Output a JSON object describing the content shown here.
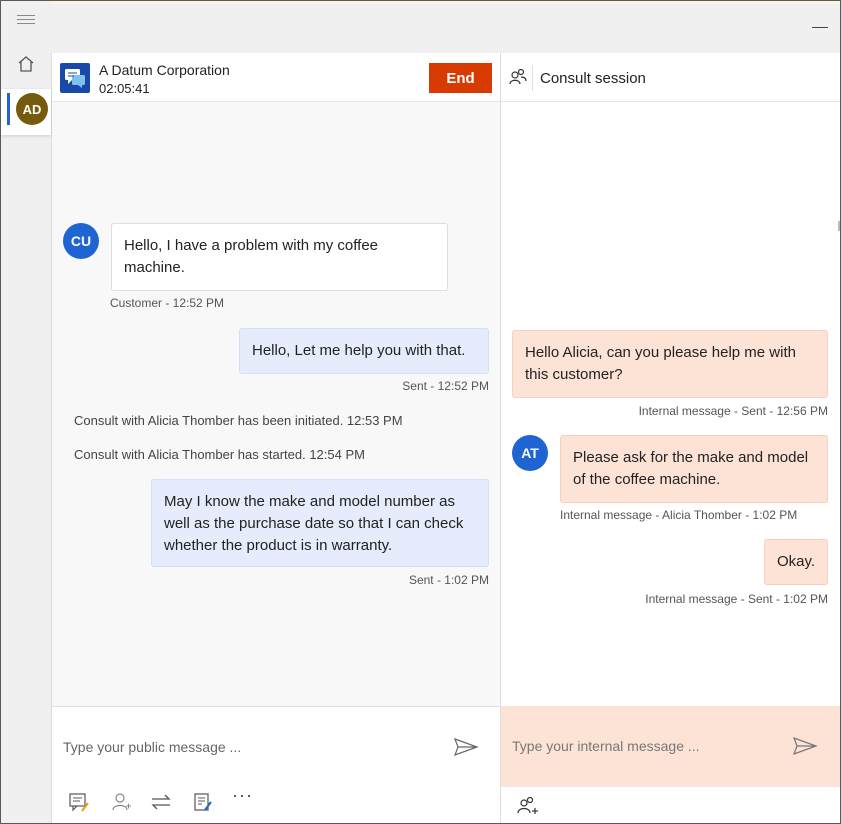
{
  "rail": {
    "avatar_initials": "AD"
  },
  "session": {
    "title": "A Datum Corporation",
    "timer": "02:05:41",
    "end_label": "End"
  },
  "conversation": {
    "customer_avatar": "CU",
    "messages": [
      {
        "kind": "customer",
        "text": "Hello, I have a problem with my coffee machine.",
        "meta": "Customer - 12:52 PM"
      },
      {
        "kind": "agent",
        "text": "Hello, Let me help you with that.",
        "meta": "Sent - 12:52 PM"
      },
      {
        "kind": "system",
        "text": "Consult with Alicia Thomber has been initiated. 12:53 PM"
      },
      {
        "kind": "system",
        "text": "Consult with Alicia Thomber has started. 12:54 PM"
      },
      {
        "kind": "agent",
        "text": "May I know the make and model number as well as the purchase date so that I can check whether the product is in warranty.",
        "meta": "Sent - 1:02 PM"
      }
    ],
    "input_placeholder": "Type your public message ..."
  },
  "consult": {
    "title": "Consult session",
    "consultant_avatar": "AT",
    "messages": [
      {
        "kind": "self",
        "text": "Hello Alicia, can you please help me with this customer?",
        "meta": "Internal message - Sent - 12:56 PM"
      },
      {
        "kind": "consultant",
        "text": "Please ask for the make and model of the coffee machine.",
        "meta": "Internal message - Alicia Thomber - 1:02 PM"
      },
      {
        "kind": "self",
        "text": "Okay.",
        "meta": "Internal message - Sent - 1:02 PM"
      }
    ],
    "input_placeholder": "Type your internal message ..."
  },
  "colors": {
    "end_button": "#d83b01",
    "avatar_blue": "#1e64d2",
    "agent_avatar": "#765a0e",
    "internal_bubble": "#fde3d6",
    "agent_bubble": "#e6ecfb"
  },
  "icons": {
    "rail": [
      "menu-icon",
      "home-icon"
    ],
    "toolbar": [
      "quick-replies-icon",
      "consult-icon",
      "transfer-icon",
      "notes-icon",
      "more-icon"
    ],
    "consult_toolbar": [
      "add-participant-icon"
    ]
  }
}
